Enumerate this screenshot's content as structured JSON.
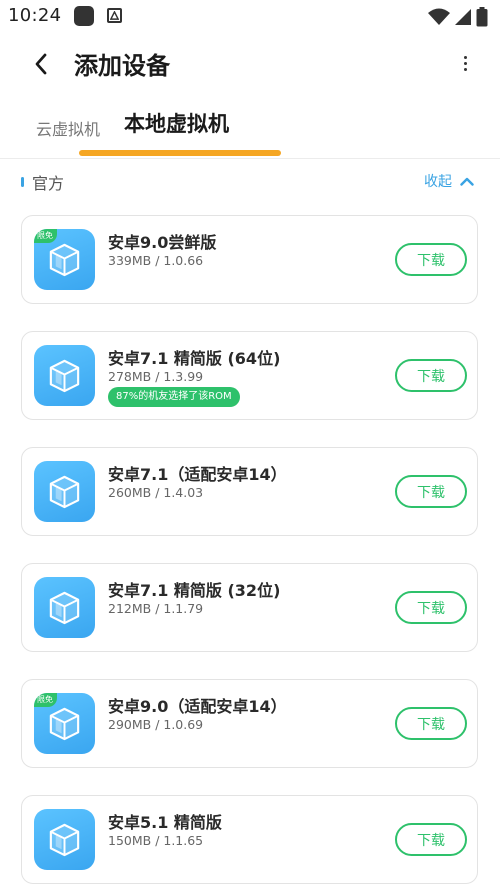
{
  "status_bar": {
    "time": "10:24"
  },
  "header": {
    "title": "添加设备"
  },
  "tabs": [
    {
      "label": "云虚拟机",
      "active": false
    },
    {
      "label": "本地虚拟机",
      "active": true
    }
  ],
  "section": {
    "title": "官方",
    "collapse_label": "收起"
  },
  "colors": {
    "accent_blue": "#3aa3e3",
    "accent_green": "#2ec16b",
    "tab_indicator": "#f5a623"
  },
  "roms": [
    {
      "name": "安卓9.0尝鲜版",
      "meta": "339MB / 1.0.66",
      "badge": "限免",
      "tag": null,
      "button": "下载"
    },
    {
      "name": "安卓7.1 精简版 (64位)",
      "meta": "278MB / 1.3.99",
      "badge": null,
      "tag": "87%的机友选择了该ROM",
      "button": "下载"
    },
    {
      "name": "安卓7.1（适配安卓14）",
      "meta": "260MB / 1.4.03",
      "badge": null,
      "tag": null,
      "button": "下载"
    },
    {
      "name": "安卓7.1 精简版 (32位)",
      "meta": "212MB / 1.1.79",
      "badge": null,
      "tag": null,
      "button": "下载"
    },
    {
      "name": "安卓9.0（适配安卓14）",
      "meta": "290MB / 1.0.69",
      "badge": "限免",
      "tag": null,
      "button": "下载"
    },
    {
      "name": "安卓5.1 精简版",
      "meta": "150MB / 1.1.65",
      "badge": null,
      "tag": null,
      "button": "下载"
    }
  ]
}
